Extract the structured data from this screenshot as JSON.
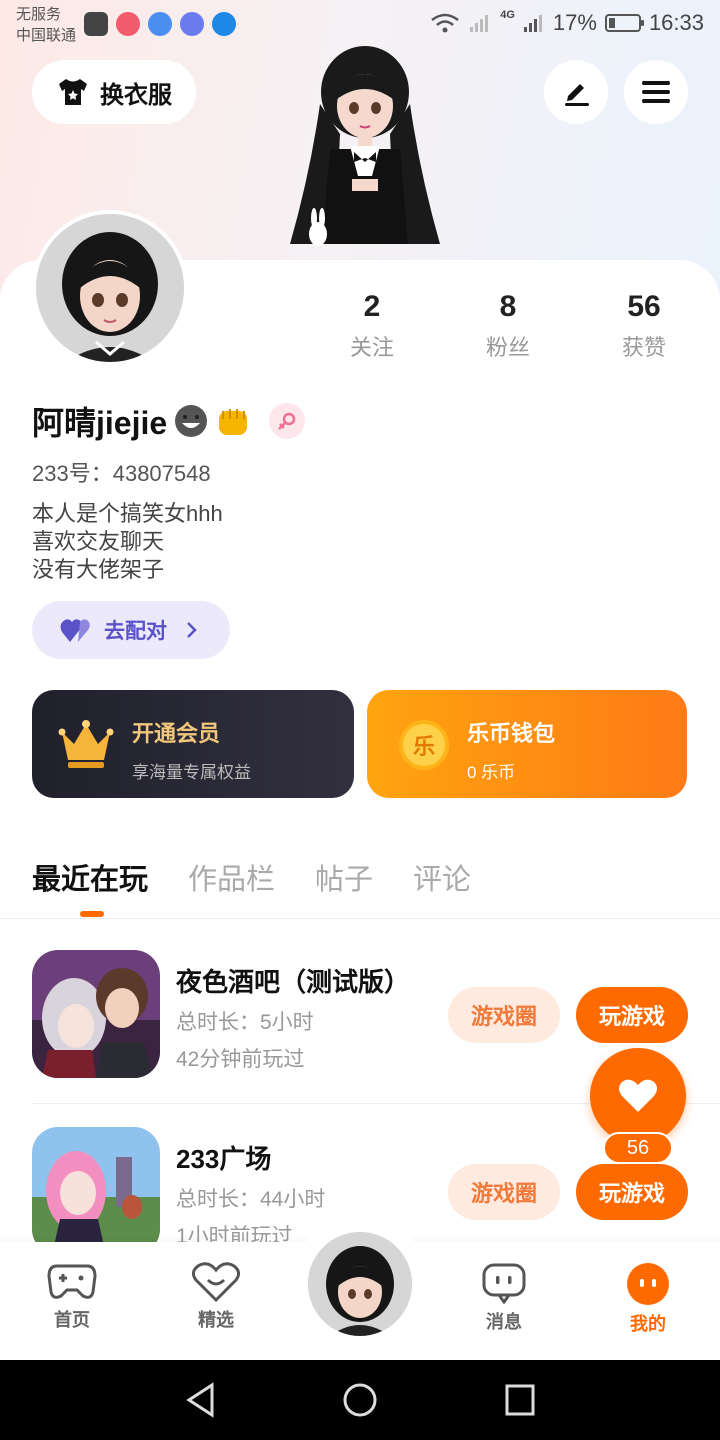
{
  "status_bar": {
    "carrier_line1": "无服务",
    "carrier_line2": "中国联通",
    "network": "4G",
    "battery": "17%",
    "time": "16:33"
  },
  "header": {
    "outfit_button": "换衣服",
    "icons": [
      "tshirt-icon",
      "edit-icon",
      "menu-icon"
    ]
  },
  "profile": {
    "stats": [
      {
        "value": "2",
        "label": "关注"
      },
      {
        "value": "8",
        "label": "粉丝"
      },
      {
        "value": "56",
        "label": "获赞"
      }
    ],
    "username": "阿晴jiejie",
    "id_label": "233号：",
    "id_value": "43807548",
    "bio": [
      "本人是个搞笑女hhh",
      "喜欢交友聊天",
      "没有大佬架子"
    ],
    "match_button": "去配对"
  },
  "cards": {
    "vip": {
      "title": "开通会员",
      "subtitle": "享海量专属权益"
    },
    "wallet": {
      "title": "乐币钱包",
      "subtitle": "0 乐币",
      "coin_char": "乐"
    }
  },
  "tabs": [
    "最近在玩",
    "作品栏",
    "帖子",
    "评论"
  ],
  "games": [
    {
      "title": "夜色酒吧（测试版）",
      "duration": "总时长：5小时",
      "last_played": "42分钟前玩过",
      "circle_button": "游戏圈",
      "play_button": "玩游戏"
    },
    {
      "title": "233广场",
      "duration": "总时长：44小时",
      "last_played": "1小时前玩过",
      "circle_button": "游戏圈",
      "play_button": "玩游戏"
    }
  ],
  "like": {
    "count": "56"
  },
  "bottom_nav": [
    {
      "label": "首页",
      "icon": "gamepad-icon"
    },
    {
      "label": "精选",
      "icon": "heart-smile-icon"
    },
    {
      "label": "消息",
      "icon": "chat-icon"
    },
    {
      "label": "我的",
      "icon": "profile-icon"
    }
  ],
  "colors": {
    "accent": "#ff6a00",
    "vip_bg": "#20202c",
    "wallet_bg": "#ff8c12",
    "match_text": "#5a52c9"
  }
}
